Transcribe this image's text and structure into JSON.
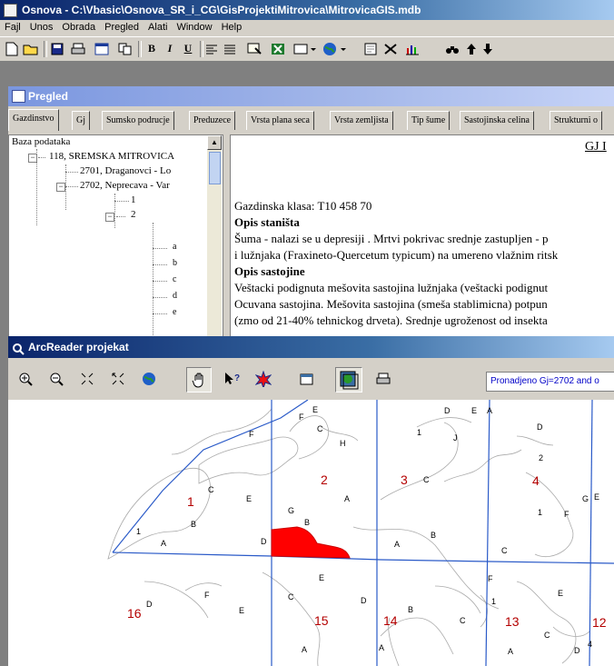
{
  "main_window": {
    "title": "Osnova - C:\\Vbasic\\Osnova_SR_i_CG\\GisProjektiMitrovica\\MitrovicaGIS.mdb",
    "menu": [
      "Fajl",
      "Unos",
      "Obrada",
      "Pregled",
      "Alati",
      "Window",
      "Help"
    ],
    "toolbar": {
      "bold": "B",
      "italic": "I",
      "underline": "U"
    }
  },
  "pregled_window": {
    "title": "Pregled",
    "tabs": [
      "Gazdinstvo",
      "Gj",
      "Sumsko podrucje",
      "Preduzece",
      "Vrsta plana seca",
      "Vrsta zemljista",
      "Tip šume",
      "Sastojinska celina",
      "Strukturni o"
    ],
    "tree": {
      "root": "Baza podataka",
      "nodes": [
        "118, SREMSKA MITROVICA",
        "2701, Draganovci - Lo",
        "2702, Neprecava - Var",
        "1",
        "2",
        "a",
        "b",
        "c",
        "d",
        "e"
      ]
    },
    "document": {
      "header": "GJ I",
      "lines": [
        "Gazdinska klasa: T10 458 70",
        "Opis staništa",
        "Šuma - nalazi se u depresiji . Mrtvi pokrivac srednje zastupljen - p",
        "i lužnjaka (Fraxineto-Quercetum typicum) na umereno vlažnim ritsk",
        "Opis sastojine",
        "Veštacki podignuta mešovita sastojina lužnjaka (veštacki podignut",
        "Ocuvana sastojina. Mešovita sastojina (smeša stablimicna) potpun",
        "(zmo od 21-40% tehnickog drveta). Srednje ugroženost od insekta"
      ]
    }
  },
  "arcreader_window": {
    "title": "ArcReader projekat",
    "status_text": "Pronadjeno Gj=2702 and o",
    "map": {
      "compartments": [
        "1",
        "2",
        "3",
        "4",
        "13",
        "14",
        "15",
        "16",
        "12"
      ],
      "subcompartment_letters": [
        "A",
        "B",
        "C",
        "D",
        "E",
        "F",
        "G",
        "H",
        "J"
      ],
      "highlight_color": "#ff0000",
      "compartment_label_color": "#b40000"
    }
  }
}
